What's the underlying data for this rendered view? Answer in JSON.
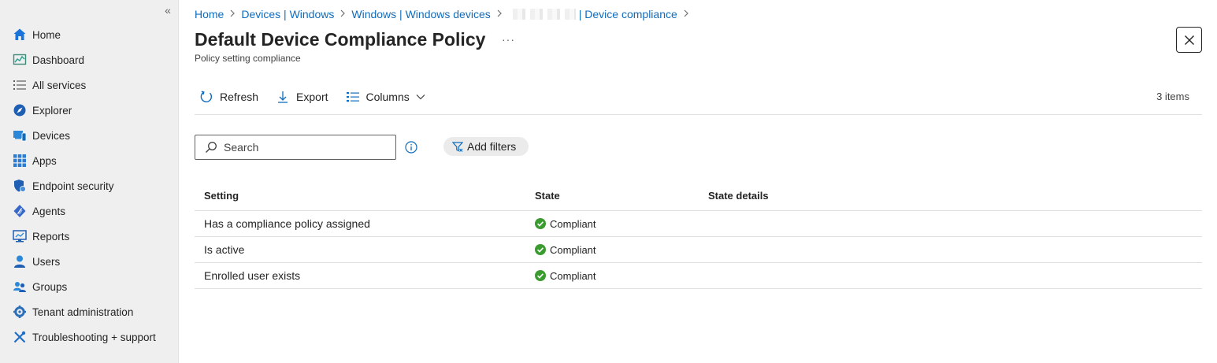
{
  "sidebar": {
    "collapse_label": "«",
    "items": [
      {
        "label": "Home",
        "icon": "home-icon"
      },
      {
        "label": "Dashboard",
        "icon": "dashboard-icon"
      },
      {
        "label": "All services",
        "icon": "list-icon"
      },
      {
        "label": "Explorer",
        "icon": "explorer-icon"
      },
      {
        "label": "Devices",
        "icon": "devices-icon"
      },
      {
        "label": "Apps",
        "icon": "apps-icon"
      },
      {
        "label": "Endpoint security",
        "icon": "shield-icon"
      },
      {
        "label": "Agents",
        "icon": "agents-icon"
      },
      {
        "label": "Reports",
        "icon": "reports-icon"
      },
      {
        "label": "Users",
        "icon": "user-icon"
      },
      {
        "label": "Groups",
        "icon": "groups-icon"
      },
      {
        "label": "Tenant administration",
        "icon": "gear-icon"
      },
      {
        "label": "Troubleshooting + support",
        "icon": "tools-icon"
      }
    ]
  },
  "breadcrumb": {
    "items": [
      "Home",
      "Devices | Windows",
      "Windows | Windows devices"
    ],
    "last": "| Device compliance"
  },
  "header": {
    "title": "Default Device Compliance Policy",
    "more": "···",
    "subtitle": "Policy setting compliance"
  },
  "toolbar": {
    "refresh_label": "Refresh",
    "export_label": "Export",
    "columns_label": "Columns",
    "items_count": "3 items"
  },
  "search": {
    "placeholder": "Search",
    "value": ""
  },
  "filters": {
    "add_label": "Add filters"
  },
  "table": {
    "columns": [
      "Setting",
      "State",
      "State details"
    ],
    "rows": [
      {
        "setting": "Has a compliance policy assigned",
        "state": "Compliant",
        "details": ""
      },
      {
        "setting": "Is active",
        "state": "Compliant",
        "details": ""
      },
      {
        "setting": "Enrolled user exists",
        "state": "Compliant",
        "details": ""
      }
    ]
  },
  "colors": {
    "link": "#0f6cbd",
    "compliant": "#3a9b2e",
    "sidebar_bg": "#efefef"
  }
}
